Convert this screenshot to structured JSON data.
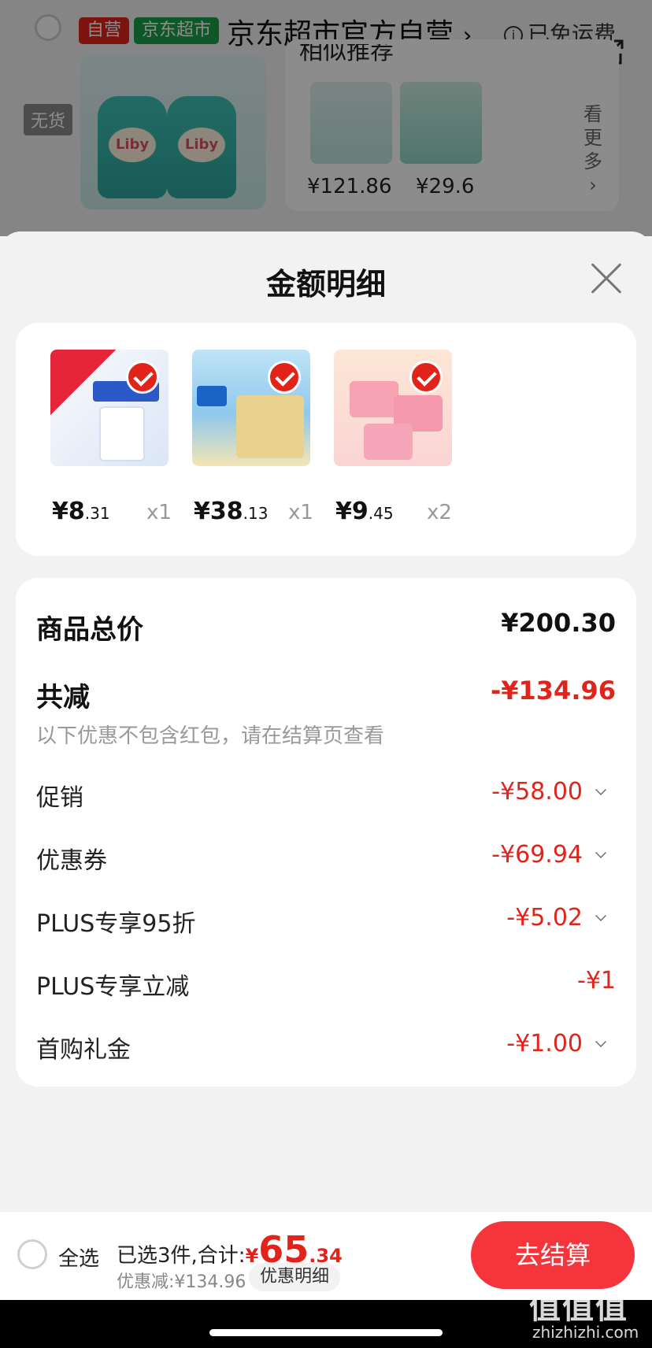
{
  "cart": {
    "store": {
      "tag_self": "自营",
      "tag_market": "京东超市",
      "name": "京东超市官方自营",
      "name_chevron": "›",
      "free_shipping": "已免运费"
    },
    "item": {
      "status": "无货",
      "brand": "Liby"
    },
    "recommend": {
      "title": "相似推荐",
      "prices": [
        "¥121.86",
        "¥29.6"
      ],
      "see_more": "看更多",
      "see_more_chevron": "›"
    }
  },
  "sheet": {
    "title": "金额明细",
    "items": [
      {
        "price_int": "¥8",
        "price_dec": ".31",
        "qty": "x1"
      },
      {
        "price_int": "¥38",
        "price_dec": ".13",
        "qty": "x1"
      },
      {
        "price_int": "¥9",
        "price_dec": ".45",
        "qty": "x2"
      }
    ],
    "total_label": "商品总价",
    "total_value": "¥200.30",
    "reduce_label": "共减",
    "reduce_value": "-¥134.96",
    "note": "以下优惠不包含红包，请在结算页查看",
    "discounts": [
      {
        "label": "促销",
        "value": "-¥58.00",
        "expandable": true
      },
      {
        "label": "优惠券",
        "value": "-¥69.94",
        "expandable": true
      },
      {
        "label": "PLUS专享95折",
        "value": "-¥5.02",
        "expandable": true
      },
      {
        "label": "PLUS专享立减",
        "value": "-¥1",
        "expandable": false
      },
      {
        "label": "首购礼金",
        "value": "-¥1.00",
        "expandable": true
      }
    ]
  },
  "footer": {
    "select_all": "全选",
    "selected_text": "已选3件,合计:",
    "sum_currency": "¥",
    "sum_int": "65",
    "sum_dec": ".34",
    "discount_text": "优惠减:¥134.96",
    "detail_button": "优惠明细",
    "checkout_button": "去结算"
  },
  "watermark": {
    "text": "值值值",
    "url": "zhizhizhi.com"
  },
  "colors": {
    "accent_red": "#e2231a",
    "checkout_red": "#f5343c",
    "tag_green": "#1aa14a"
  }
}
